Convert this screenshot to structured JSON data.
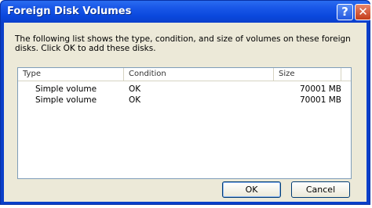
{
  "window": {
    "title": "Foreign Disk Volumes",
    "help_label": "?",
    "close_label": "✕"
  },
  "description": "The following list shows the type, condition, and size of volumes on these foreign disks. Click OK to add these disks.",
  "table": {
    "columns": [
      "Type",
      "Condition",
      "Size"
    ],
    "rows": [
      [
        "Simple volume",
        "OK",
        "70001 MB"
      ],
      [
        "Simple volume",
        "OK",
        "70001 MB"
      ]
    ]
  },
  "buttons": {
    "ok": "OK",
    "cancel": "Cancel"
  }
}
